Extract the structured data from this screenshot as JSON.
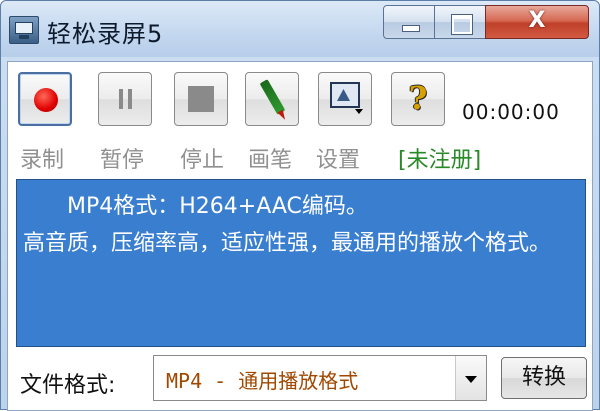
{
  "window": {
    "title": "轻松录屏5",
    "close_glyph": "X"
  },
  "toolbar": {
    "timer": "00:00:00",
    "labels": {
      "record": "录制",
      "pause": "暂停",
      "stop": "停止",
      "pen": "画笔",
      "settings": "设置",
      "unregistered": "[未注册]"
    },
    "help_glyph": "?"
  },
  "info": {
    "line1": "MP4格式：H264+AAC编码。",
    "line2": "高音质，压缩率高，适应性强，最通用的播放个格式。"
  },
  "bottom": {
    "format_label": "文件格式:",
    "format_selected": "MP4 - 通用播放格式",
    "convert_label": "转换"
  },
  "colors": {
    "info_background": "#3a7ed0",
    "record_red": "#e00000",
    "registered_green": "#2a8a2a",
    "format_value": "#a04800"
  },
  "icons": [
    "app-icon",
    "minimize-icon",
    "maximize-icon",
    "close-icon",
    "record-icon",
    "pause-icon",
    "stop-icon",
    "pen-icon",
    "settings-icon",
    "help-icon",
    "dropdown-arrow-icon"
  ]
}
